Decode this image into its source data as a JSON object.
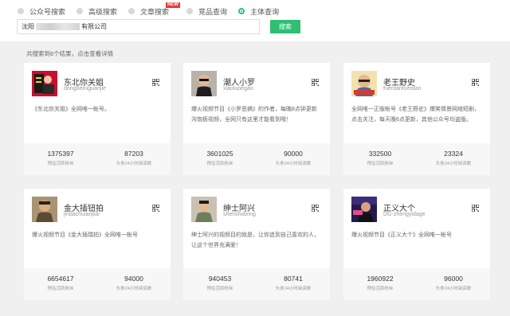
{
  "search_types": [
    {
      "label": "公众号搜索",
      "selected": false,
      "badge": ""
    },
    {
      "label": "高级搜索",
      "selected": false,
      "badge": ""
    },
    {
      "label": "文章搜索",
      "selected": false,
      "badge": "NEW"
    },
    {
      "label": "竞品查询",
      "selected": false,
      "badge": ""
    },
    {
      "label": "主体查询",
      "selected": true,
      "badge": ""
    }
  ],
  "search": {
    "query_prefix": "沈阳",
    "query_suffix": "有限公司",
    "button_label": "搜索"
  },
  "result_summary": "共搜索到6个结果，点击查看详情",
  "stat_labels": {
    "fans": "预估活跃粉丝",
    "reads": "头条24小时阅读数"
  },
  "accounts": [
    {
      "name": "东北你关姐",
      "account_id": "dongbeiniguanjie",
      "description": "《东北你关姐》全网唯一帐号。",
      "fans": "1375397",
      "reads": "87203"
    },
    {
      "name": "潮人小罗",
      "account_id": "xiaoluoegao",
      "description": "爆火视频节目《小罗恶搞》的作者，每晚8点钟更新沟饱板视频，全网只有这里才能看到哦！",
      "fans": "3601025",
      "reads": "90000"
    },
    {
      "name": "老王野史",
      "account_id": "fuerdanfuerdan",
      "description": "全网唯一正版帐号《老王野史》爆笑情景网络短剧，点击关注，每天晚6点更新，其他公众号均盗版。",
      "fans": "332500",
      "reads": "23324"
    },
    {
      "name": "金大插钮拍",
      "account_id": "jindachuianpai",
      "description": "爆火视频节目《金大插瑞拍》全网唯一帐号",
      "fans": "6654617",
      "reads": "94000"
    },
    {
      "name": "绅士阿兴",
      "account_id": "shenshiaxing",
      "description": "绅士阿兴的视频目的就是，让你追到自己喜欢的人，让这个世界充满爱！",
      "fans": "940453",
      "reads": "80741"
    },
    {
      "name": "正义大个",
      "account_id": "DG-zhengyidage",
      "description": "爆火视频节目《正义大个》全网唯一帐号",
      "fans": "1960922",
      "reads": "96000"
    }
  ],
  "colors": {
    "accent": "#2ebf73",
    "badge": "#e23b3b",
    "page_bg": "#f0f0f0"
  }
}
